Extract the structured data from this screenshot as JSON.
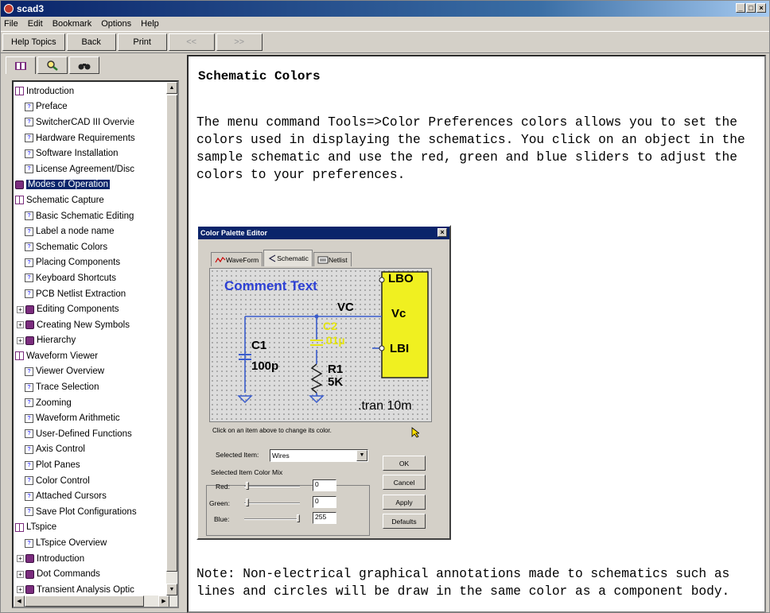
{
  "window": {
    "title": "scad3",
    "controls": [
      "_",
      "□",
      "×"
    ]
  },
  "menu": [
    "File",
    "Edit",
    "Bookmark",
    "Options",
    "Help"
  ],
  "toolbar": {
    "help_topics": "Help Topics",
    "back": "Back",
    "print": "Print",
    "prev": "<<",
    "next": ">>"
  },
  "nav_tabs": [
    "contents-icon",
    "search-icon",
    "find-icon"
  ],
  "tree": [
    {
      "label": "Introduction",
      "type": "bookopen",
      "indent": 0
    },
    {
      "label": "Preface",
      "type": "page",
      "indent": 1
    },
    {
      "label": "SwitcherCAD III Overvie",
      "type": "page",
      "indent": 1
    },
    {
      "label": "Hardware Requirements",
      "type": "page",
      "indent": 1
    },
    {
      "label": "Software Installation",
      "type": "page",
      "indent": 1
    },
    {
      "label": "License Agreement/Disc",
      "type": "page",
      "indent": 1
    },
    {
      "label": "Modes of Operation",
      "type": "book",
      "indent": 0,
      "selected": true
    },
    {
      "label": "Schematic Capture",
      "type": "bookopen",
      "indent": 0
    },
    {
      "label": "Basic Schematic Editing",
      "type": "page",
      "indent": 1
    },
    {
      "label": "Label a node name",
      "type": "page",
      "indent": 1
    },
    {
      "label": "Schematic Colors",
      "type": "page",
      "indent": 1
    },
    {
      "label": "Placing Components",
      "type": "page",
      "indent": 1
    },
    {
      "label": "Keyboard Shortcuts",
      "type": "page",
      "indent": 1
    },
    {
      "label": "PCB Netlist Extraction",
      "type": "page",
      "indent": 1
    },
    {
      "label": "Editing Components",
      "type": "book",
      "indent": 1,
      "plus": true
    },
    {
      "label": "Creating New Symbols",
      "type": "book",
      "indent": 1,
      "plus": true
    },
    {
      "label": "Hierarchy",
      "type": "book",
      "indent": 1,
      "plus": true
    },
    {
      "label": "Waveform Viewer",
      "type": "bookopen",
      "indent": 0
    },
    {
      "label": "Viewer Overview",
      "type": "page",
      "indent": 1
    },
    {
      "label": "Trace Selection",
      "type": "page",
      "indent": 1
    },
    {
      "label": "Zooming",
      "type": "page",
      "indent": 1
    },
    {
      "label": "Waveform Arithmetic",
      "type": "page",
      "indent": 1
    },
    {
      "label": "User-Defined Functions",
      "type": "page",
      "indent": 1
    },
    {
      "label": "Axis Control",
      "type": "page",
      "indent": 1
    },
    {
      "label": "Plot Panes",
      "type": "page",
      "indent": 1
    },
    {
      "label": "Color Control",
      "type": "page",
      "indent": 1
    },
    {
      "label": "Attached Cursors",
      "type": "page",
      "indent": 1
    },
    {
      "label": "Save Plot Configurations",
      "type": "page",
      "indent": 1
    },
    {
      "label": "LTspice",
      "type": "bookopen",
      "indent": 0
    },
    {
      "label": "LTspice Overview",
      "type": "page",
      "indent": 1
    },
    {
      "label": "Introduction",
      "type": "book",
      "indent": 1,
      "plus": true
    },
    {
      "label": "Dot Commands",
      "type": "book",
      "indent": 1,
      "plus": true
    },
    {
      "label": "Transient Analysis Optic",
      "type": "book",
      "indent": 1,
      "plus": true
    }
  ],
  "content": {
    "title": "Schematic Colors",
    "para1": "The menu command Tools=>Color Preferences colors allows you to set the colors used in displaying the schematics.  You click on an object in the sample schematic and use the red, green and blue sliders to adjust the colors to your preferences.",
    "para2": "Note: Non-electrical graphical annotations made to schematics such as lines and circles will be draw in the same color as a component body."
  },
  "dialog": {
    "title": "Color Palette Editor",
    "tabs": [
      "WaveForm",
      "Schematic",
      "Netlist"
    ],
    "schematic": {
      "comment": "Comment Text",
      "vc": "VC",
      "c1": "C1",
      "c1v": "100p",
      "c2": "C2",
      "c2v": ".01µ",
      "r1": "R1",
      "r1v": "5K",
      "lbo": "LBO",
      "vcpin": "Vc",
      "lbi": "LBI",
      "tran": ".tran 10m"
    },
    "hint": "Click on an item above to change its color.",
    "selected_item_label": "Selected Item:",
    "selected_item": "Wires",
    "mix_label": "Selected Item Color Mix",
    "red_label": "Red:",
    "green_label": "Green:",
    "blue_label": "Blue:",
    "red": "0",
    "green": "0",
    "blue": "255",
    "buttons": {
      "ok": "OK",
      "cancel": "Cancel",
      "apply": "Apply",
      "defaults": "Defaults"
    }
  },
  "colors": {
    "wire": "#3a5ccc",
    "comment": "#2c3fd4",
    "c2": "#e5e510",
    "block": "#f0f020",
    "selected_bg": "#0a246a"
  }
}
